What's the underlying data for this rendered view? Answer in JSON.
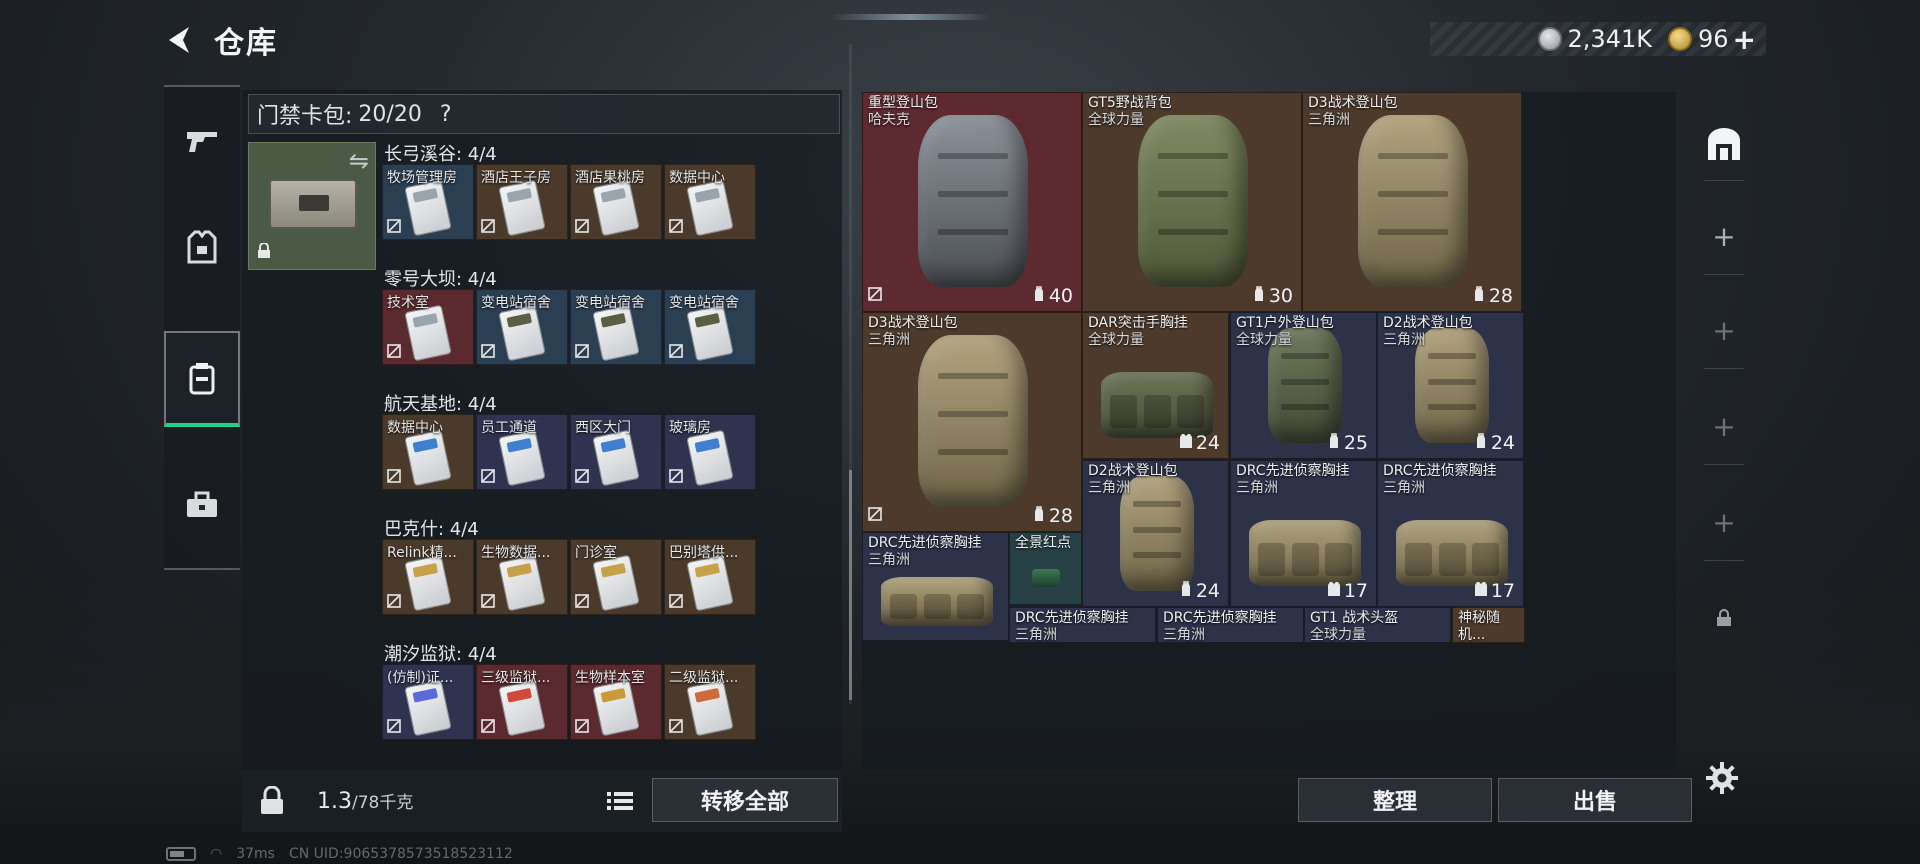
{
  "header": {
    "title": "仓库",
    "currency_silver": "2,341K",
    "currency_gold": "96",
    "plus": "+"
  },
  "nav": {
    "items": [
      "weapon",
      "armor",
      "cardpack",
      "toolbox"
    ],
    "active": "cardpack"
  },
  "card_pack": {
    "header_label": "门禁卡包:",
    "header_count": "20/20",
    "help": "?",
    "groups": [
      {
        "title": "长弓溪谷: 4/4",
        "slots": [
          {
            "label": "牧场管理房",
            "color": "blue",
            "stripe": "#9aa4ad"
          },
          {
            "label": "酒店王子房",
            "color": "brown",
            "stripe": "#9aa4ad"
          },
          {
            "label": "酒店果桃房",
            "color": "brown",
            "stripe": "#9aa4ad"
          },
          {
            "label": "数据中心",
            "color": "brown",
            "stripe": "#9aa4ad"
          }
        ]
      },
      {
        "title": "零号大坝: 4/4",
        "slots": [
          {
            "label": "技术室",
            "color": "red",
            "stripe": "#9aa4ad"
          },
          {
            "label": "变电站宿舍",
            "color": "blue",
            "stripe": "#5a5f44"
          },
          {
            "label": "变电站宿舍",
            "color": "blue",
            "stripe": "#5a5f44"
          },
          {
            "label": "变电站宿舍",
            "color": "blue",
            "stripe": "#5a5f44"
          }
        ]
      },
      {
        "title": "航天基地: 4/4",
        "slots": [
          {
            "label": "数据中心",
            "color": "brown",
            "stripe": "#3f7fd0"
          },
          {
            "label": "员工通道",
            "color": "purple",
            "stripe": "#3f7fd0"
          },
          {
            "label": "西区大门",
            "color": "purple",
            "stripe": "#3f7fd0"
          },
          {
            "label": "玻璃房",
            "color": "purple",
            "stripe": "#3f7fd0"
          }
        ]
      },
      {
        "title": "巴克什: 4/4",
        "slots": [
          {
            "label": "Relink精...",
            "color": "brown",
            "stripe": "#c9a04a"
          },
          {
            "label": "生物数据...",
            "color": "brown",
            "stripe": "#c9a04a"
          },
          {
            "label": "门诊室",
            "color": "brown",
            "stripe": "#c9a04a"
          },
          {
            "label": "巴别塔供...",
            "color": "brown",
            "stripe": "#c9a04a"
          }
        ]
      },
      {
        "title": "潮汐监狱: 4/4",
        "slots": [
          {
            "label": "(仿制)证...",
            "color": "purple",
            "stripe": "#5a6bd8"
          },
          {
            "label": "三级监狱...",
            "color": "red",
            "stripe": "#d04a3a"
          },
          {
            "label": "生物样本室",
            "color": "red",
            "stripe": "#c99a3a"
          },
          {
            "label": "二级监狱...",
            "color": "brown",
            "stripe": "#d06a3a"
          }
        ]
      }
    ]
  },
  "footer_left": {
    "weight": "1.3",
    "capacity": "/78千克",
    "transfer_all": "转移全部"
  },
  "items": [
    {
      "name": "重型登山包",
      "sub": "哈夫克",
      "count": "40",
      "count_icon": "bag",
      "color": "red",
      "no_insure": true
    },
    {
      "name": "GT5野战背包",
      "sub": "全球力量",
      "count": "30",
      "count_icon": "bag",
      "color": "brown",
      "no_insure": false
    },
    {
      "name": "D3战术登山包",
      "sub": "三角洲",
      "count": "28",
      "count_icon": "bag",
      "color": "brown",
      "no_insure": false
    },
    {
      "name": "D3战术登山包",
      "sub": "三角洲",
      "count": "28",
      "count_icon": "bag",
      "color": "brown",
      "no_insure": true
    },
    {
      "name": "DAR突击手胸挂",
      "sub": "全球力量",
      "count": "24",
      "count_icon": "vest",
      "color": "brown",
      "no_insure": false
    },
    {
      "name": "GT1户外登山包",
      "sub": "全球力量",
      "count": "25",
      "count_icon": "bag",
      "color": "purple",
      "no_insure": false
    },
    {
      "name": "D2战术登山包",
      "sub": "三角洲",
      "count": "24",
      "count_icon": "bag",
      "color": "purple",
      "no_insure": false
    },
    {
      "name": "D2战术登山包",
      "sub": "三角洲",
      "count": "24",
      "count_icon": "bag",
      "color": "purple",
      "no_insure": false
    },
    {
      "name": "DRC先进侦察胸挂",
      "sub": "三角洲",
      "count": "17",
      "count_icon": "vest",
      "color": "purple",
      "no_insure": false
    },
    {
      "name": "DRC先进侦察胸挂",
      "sub": "三角洲",
      "count": "17",
      "count_icon": "vest",
      "color": "purple",
      "no_insure": false
    },
    {
      "name": "DRC先进侦察胸挂",
      "sub": "三角洲",
      "count": "",
      "count_icon": "",
      "color": "purple",
      "no_insure": false
    },
    {
      "name": "全景红点",
      "sub": "",
      "count": "",
      "count_icon": "",
      "color": "teal",
      "no_insure": false
    },
    {
      "name": "DRC先进侦察胸挂",
      "sub": "三角洲",
      "count": "",
      "count_icon": "",
      "color": "purple",
      "no_insure": false
    },
    {
      "name": "DRC先进侦察胸挂",
      "sub": "三角洲",
      "count": "",
      "count_icon": "",
      "color": "purple",
      "no_insure": false
    },
    {
      "name": "GT1 战术头盔",
      "sub": "全球力量",
      "count": "",
      "count_icon": "",
      "color": "purple",
      "no_insure": false
    },
    {
      "name": "神秘随机...",
      "sub": "",
      "count": "",
      "count_icon": "",
      "color": "brown",
      "no_insure": false
    }
  ],
  "actions": {
    "organize": "整理",
    "sell": "出售"
  },
  "right_column": {
    "plus": "+"
  },
  "status": {
    "ping": "37ms",
    "uid": "CN UID:9065378573518523112"
  },
  "colors": {
    "accent_green": "#1fd08a",
    "slot_red": "#5c2a2f",
    "slot_brown": "#4d3a2b",
    "slot_purple": "#2e3249",
    "slot_blue": "#2a3f52"
  }
}
